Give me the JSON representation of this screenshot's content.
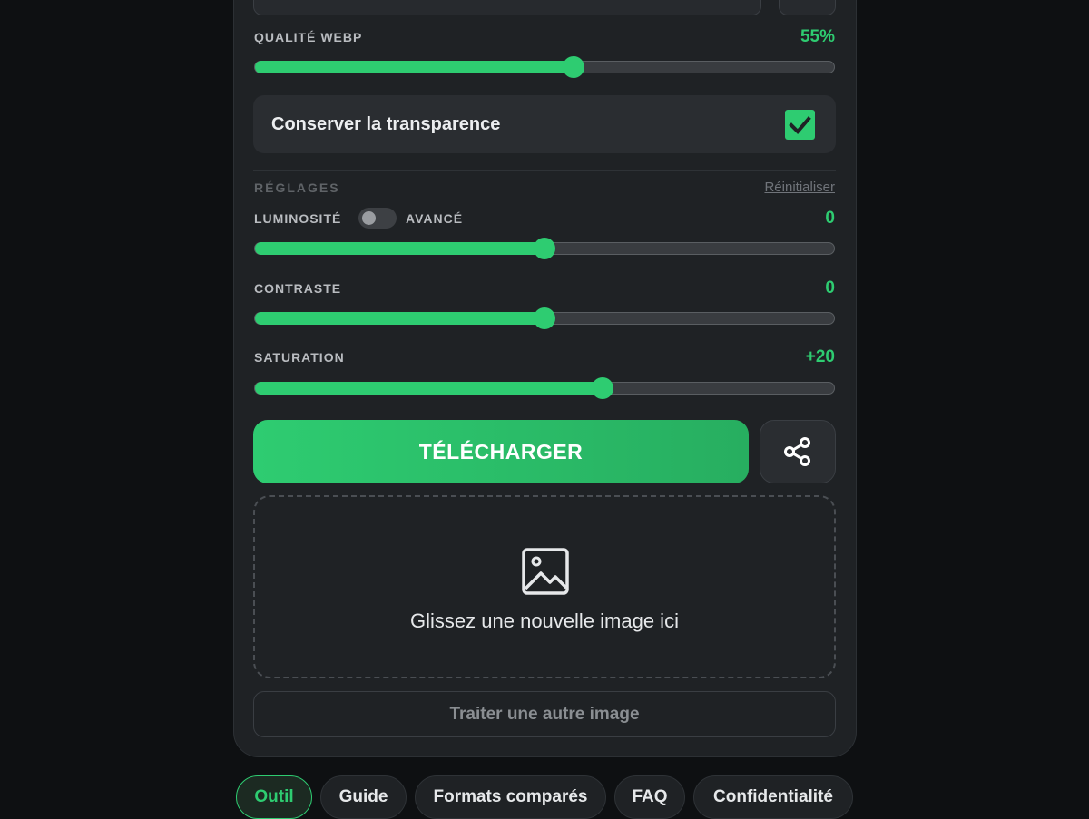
{
  "webp_quality": {
    "label": "QUALITÉ WEBP",
    "value_text": "55%",
    "value": 55
  },
  "transparency": {
    "label": "Conserver la transparence",
    "checked": true
  },
  "settings": {
    "section_title": "RÉGLAGES",
    "reset_label": "Réinitialiser",
    "brightness": {
      "label": "LUMINOSITÉ",
      "value_text": "0",
      "value": 0
    },
    "advanced_label": "AVANCÉ",
    "advanced_on": false,
    "contrast": {
      "label": "CONTRASTE",
      "value_text": "0",
      "value": 0
    },
    "saturation": {
      "label": "SATURATION",
      "value_text": "+20",
      "value": 20
    }
  },
  "actions": {
    "download_label": "TÉLÉCHARGER",
    "share_icon": "share-icon"
  },
  "dropzone": {
    "icon": "image-icon",
    "text": "Glissez une nouvelle image ici"
  },
  "other_image_label": "Traiter une autre image",
  "tabs": [
    {
      "label": "Outil",
      "active": true
    },
    {
      "label": "Guide",
      "active": false
    },
    {
      "label": "Formats comparés",
      "active": false
    },
    {
      "label": "FAQ",
      "active": false
    },
    {
      "label": "Confidentialité",
      "active": false
    }
  ],
  "colors": {
    "accent": "#2ecc71",
    "background": "#0e1012",
    "card": "#1f2225"
  }
}
